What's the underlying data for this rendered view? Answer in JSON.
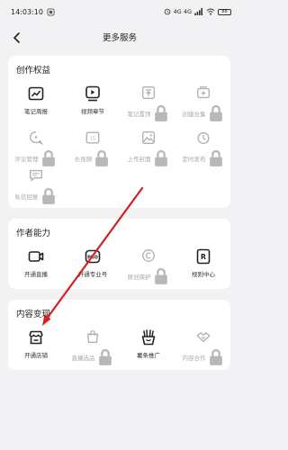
{
  "status_bar": {
    "time": "14:03:10",
    "network": "4G 4G",
    "battery": "88"
  },
  "header": {
    "title": "更多服务"
  },
  "sections": [
    {
      "title": "创作权益",
      "items": [
        {
          "label": "笔记周报",
          "icon": "chart-icon",
          "enabled": true
        },
        {
          "label": "视频章节",
          "icon": "video-chapter-icon",
          "enabled": true
        },
        {
          "label": "笔记置顶",
          "icon": "pin-top-icon",
          "enabled": false
        },
        {
          "label": "创建合集",
          "icon": "collection-add-icon",
          "enabled": false
        },
        {
          "label": "评论管理",
          "icon": "comment-manage-icon",
          "enabled": false
        },
        {
          "label": "长视频",
          "icon": "long-video-icon",
          "enabled": false
        },
        {
          "label": "上传封面",
          "icon": "upload-cover-icon",
          "enabled": false
        },
        {
          "label": "定时发布",
          "icon": "timer-icon",
          "enabled": false
        },
        {
          "label": "私信回复",
          "icon": "message-reply-icon",
          "enabled": false
        }
      ]
    },
    {
      "title": "作者能力",
      "items": [
        {
          "label": "开通直播",
          "icon": "live-icon",
          "enabled": true
        },
        {
          "label": "开通专业号",
          "icon": "pro-account-icon",
          "enabled": true
        },
        {
          "label": "原创保护",
          "icon": "copyright-icon",
          "enabled": false
        },
        {
          "label": "规则中心",
          "icon": "rules-center-icon",
          "enabled": true
        }
      ]
    },
    {
      "title": "内容变现",
      "items": [
        {
          "label": "开通店铺",
          "icon": "store-icon",
          "enabled": true
        },
        {
          "label": "直播选品",
          "icon": "shopping-bag-icon",
          "enabled": false
        },
        {
          "label": "薯条推广",
          "icon": "fries-promo-icon",
          "enabled": true
        },
        {
          "label": "内容合作",
          "icon": "cooperation-icon",
          "enabled": false
        }
      ]
    }
  ],
  "colors": {
    "annotation_arrow": "#d42020",
    "disabled_text": "#a8a8a8",
    "background": "#f2f2f4"
  }
}
